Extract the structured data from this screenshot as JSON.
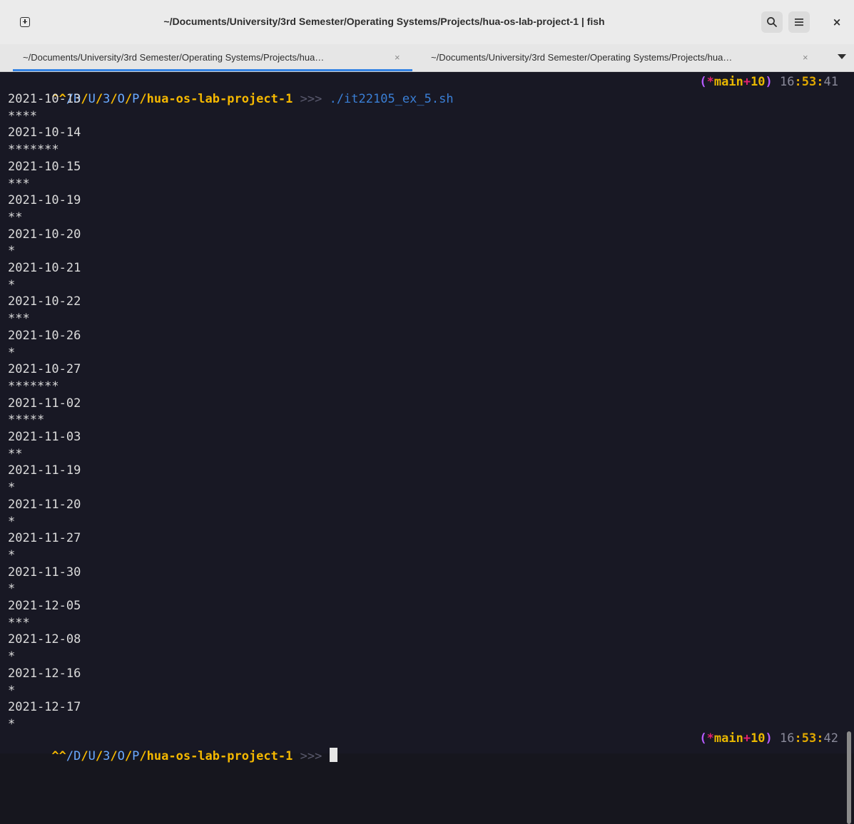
{
  "window": {
    "title": "~/Documents/University/3rd Semester/Operating Systems/Projects/hua-os-lab-project-1 | fish"
  },
  "headerbar": {
    "new_tab_icon": "new-tab-icon",
    "search_icon": "search-icon",
    "menu_icon": "hamburger-menu-icon",
    "close_glyph": "×"
  },
  "tabs": [
    {
      "label": "~/Documents/University/3rd Semester/Operating Systems/Projects/hua…",
      "close": "×",
      "active": true
    },
    {
      "label": "~/Documents/University/3rd Semester/Operating Systems/Projects/hua…",
      "close": "×",
      "active": false
    }
  ],
  "prompt": {
    "carets": "^^",
    "path_parts": [
      "/",
      "D",
      "/",
      "U",
      "/",
      "3",
      "/",
      "O",
      "/",
      "P",
      "/"
    ],
    "dir": "hua-os-lab-project-1",
    "arrows": ">>>",
    "command": "./it22105_ex_5.sh",
    "branch_open": "(",
    "branch_star": "*",
    "branch_name": "main",
    "branch_plus": "+",
    "branch_count": "10",
    "branch_close": ")",
    "time_h": "16",
    "time_sep1": ":",
    "time_m": "53",
    "time_sep2": ":",
    "time_s": "41"
  },
  "output_lines": [
    "2021-10-13",
    "****",
    "2021-10-14",
    "*******",
    "2021-10-15",
    "***",
    "2021-10-19",
    "**",
    "2021-10-20",
    "*",
    "2021-10-21",
    "*",
    "2021-10-22",
    "***",
    "2021-10-26",
    "*",
    "2021-10-27",
    "*******",
    "2021-11-02",
    "*****",
    "2021-11-03",
    "**",
    "2021-11-19",
    "*",
    "2021-11-20",
    "*",
    "2021-11-27",
    "*",
    "2021-11-30",
    "*",
    "2021-12-05",
    "***",
    "2021-12-08",
    "*",
    "2021-12-16",
    "*",
    "2021-12-17",
    "*"
  ],
  "prompt2": {
    "carets": "^^",
    "path_parts": [
      "/",
      "D",
      "/",
      "U",
      "/",
      "3",
      "/",
      "O",
      "/",
      "P",
      "/"
    ],
    "dir": "hua-os-lab-project-1",
    "arrows": ">>>",
    "branch_open": "(",
    "branch_star": "*",
    "branch_name": "main",
    "branch_plus": "+",
    "branch_count": "10",
    "branch_close": ")",
    "time_h": "16",
    "time_sep1": ":",
    "time_m": "53",
    "time_sep2": ":",
    "time_s": "42"
  },
  "colors": {
    "terminal_bg": "#181824",
    "accent_tab_indicator": "#3584e4",
    "prompt_yellow": "#f5b800",
    "branch_pink": "#e0226e"
  }
}
